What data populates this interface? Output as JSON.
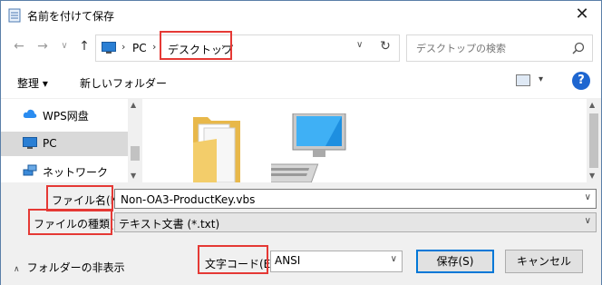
{
  "window": {
    "title": "名前を付けて保存",
    "close_glyph": "✕"
  },
  "nav": {
    "back_glyph": "←",
    "forward_glyph": "→",
    "recent_glyph": "∨",
    "up_glyph": "↑",
    "breadcrumb": [
      "PC",
      "デスクトップ"
    ],
    "separator_glyph": "›",
    "dropdown_glyph": "∨",
    "refresh_glyph": "↻",
    "search_placeholder": "デスクトップの検索"
  },
  "toolbar": {
    "organize_label": "整理 ▾",
    "new_folder_label": "新しいフォルダー",
    "view_dropdown_glyph": "▾",
    "help_label": "?"
  },
  "nav_pane": {
    "items": [
      {
        "label": "WPS网盘",
        "icon": "cloud-icon"
      },
      {
        "label": "PC",
        "icon": "computer-icon",
        "selected": true
      },
      {
        "label": "ネットワーク",
        "icon": "network-icon"
      }
    ],
    "scroll_up_glyph": "▲",
    "scroll_down_glyph": "▼"
  },
  "form": {
    "filename_label": "ファイル名(N):",
    "filename_value": "Non-OA3-ProductKey.vbs",
    "filetype_label": "ファイルの種類(T):",
    "filetype_value": "テキスト文書 (*.txt)",
    "encoding_label": "文字コード(E):",
    "encoding_value": "ANSI",
    "save_label": "保存(S)",
    "cancel_label": "キャンセル",
    "hide_folders_label": "フォルダーの非表示",
    "hide_folders_glyph": "∧",
    "dropdown_glyph": "∨"
  },
  "colors": {
    "highlight_box": "#e53935",
    "accent": "#0078d7",
    "help": "#1e66d0"
  }
}
